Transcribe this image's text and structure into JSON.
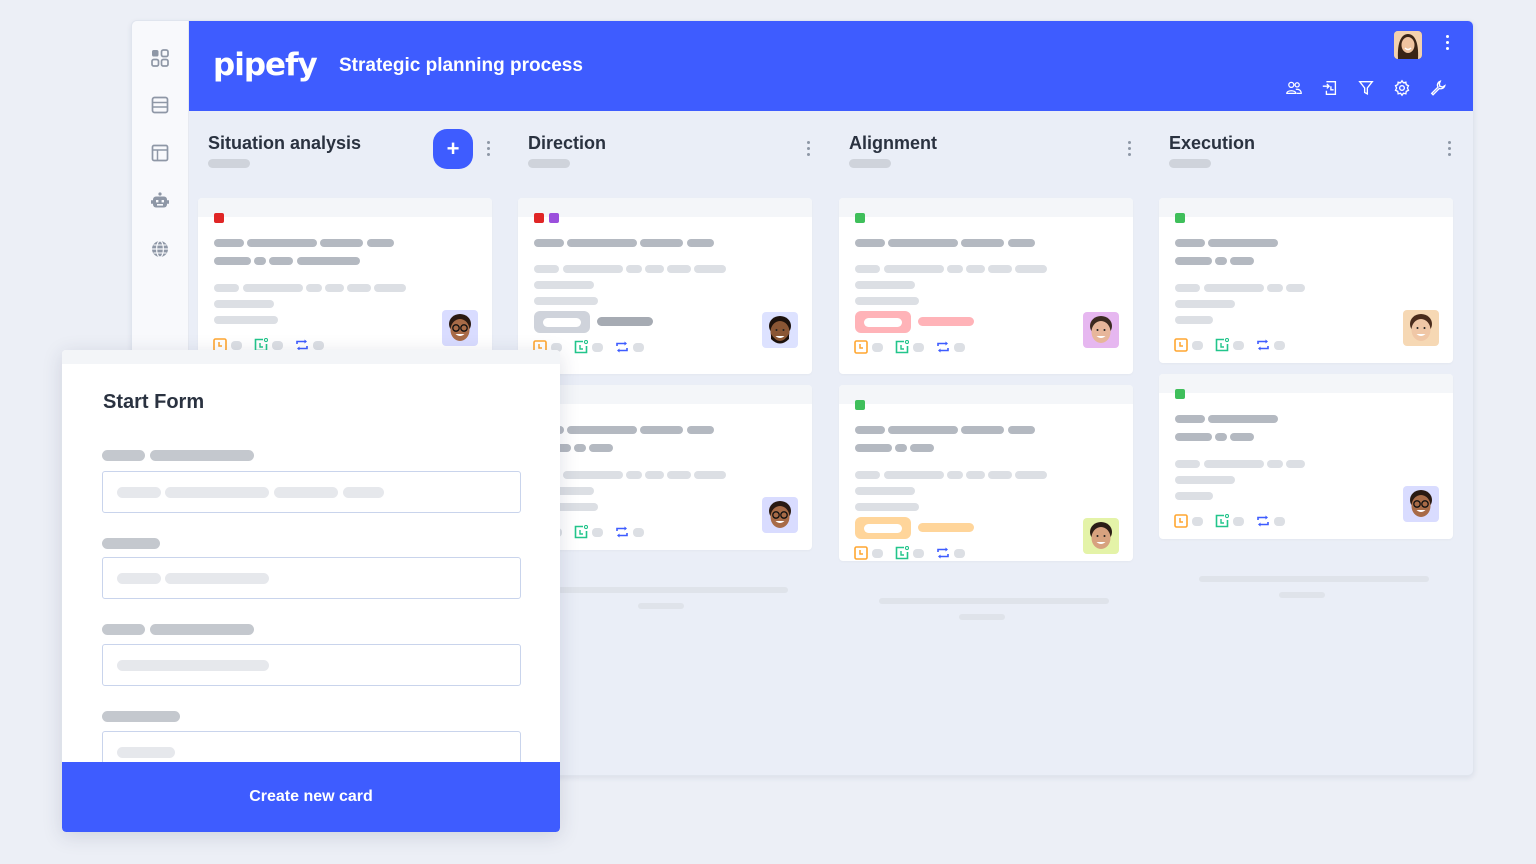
{
  "app": {
    "brand": "pipefy",
    "title": "Strategic planning process",
    "accent_color": "#3e5cff"
  },
  "sidebar": {
    "items": [
      {
        "icon": "grid-icon",
        "label": "Dashboards"
      },
      {
        "icon": "database-icon",
        "label": "Databases"
      },
      {
        "icon": "layout-icon",
        "label": "Interfaces"
      },
      {
        "icon": "robot-icon",
        "label": "Automations"
      },
      {
        "icon": "globe-icon",
        "label": "Portals"
      }
    ]
  },
  "header": {
    "icons": [
      "members-icon",
      "import-icon",
      "filter-icon",
      "settings-icon",
      "wrench-icon"
    ],
    "menu_icon": "more-vertical-icon"
  },
  "columns": [
    {
      "title": "Situation analysis",
      "has_add_button": true,
      "add_label": "+",
      "cards": [
        {
          "tags": [
            "#e02626"
          ],
          "label_color": null,
          "avatar": "man-glasses"
        }
      ]
    },
    {
      "title": "Direction",
      "has_add_button": false,
      "cards": [
        {
          "tags": [
            "#e02626",
            "#9b4fdc"
          ],
          "label_color": "#cfd3db",
          "avatar": "man-beard"
        },
        {
          "tags": [],
          "label_color": null,
          "avatar": "man-glasses"
        }
      ]
    },
    {
      "title": "Alignment",
      "has_add_button": false,
      "cards": [
        {
          "tags": [
            "#3fbf5b"
          ],
          "label_color": "#ffb3b8",
          "avatar": "man-smile-pink"
        },
        {
          "tags": [
            "#3fbf5b"
          ],
          "label_color": "#ffd59a",
          "avatar": "man-smile-green"
        }
      ]
    },
    {
      "title": "Execution",
      "has_add_button": false,
      "cards": [
        {
          "tags": [
            "#3fbf5b"
          ],
          "label_color": null,
          "avatar": "woman-smile"
        },
        {
          "tags": [
            "#3fbf5b"
          ],
          "label_color": null,
          "avatar": "man-glasses"
        }
      ]
    }
  ],
  "card_icons": [
    "clock-icon",
    "due-date-icon",
    "repeat-icon"
  ],
  "start_form": {
    "title": "Start Form",
    "fields": 4,
    "submit_label": "Create new card"
  }
}
